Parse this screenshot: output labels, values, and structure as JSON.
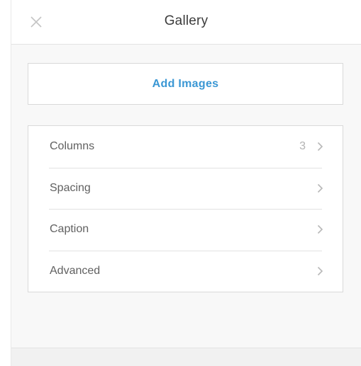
{
  "panel": {
    "title": "Gallery",
    "close_icon": "close-icon"
  },
  "actions": {
    "add_images_label": "Add Images",
    "accent_color": "#3a97d4"
  },
  "menu": {
    "items": [
      {
        "label": "Columns",
        "value": "3",
        "icon": "chevron-right-icon"
      },
      {
        "label": "Spacing",
        "value": "",
        "icon": "chevron-right-icon"
      },
      {
        "label": "Caption",
        "value": "",
        "icon": "chevron-right-icon"
      },
      {
        "label": "Advanced",
        "value": "",
        "icon": "chevron-right-icon"
      }
    ]
  }
}
